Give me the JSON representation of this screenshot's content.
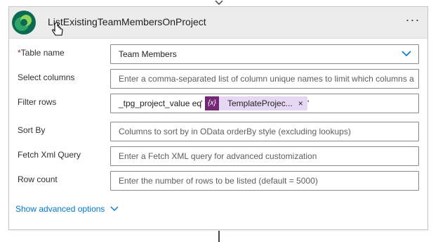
{
  "action": {
    "title": "ListExistingTeamMembersOnProject",
    "more_label": "···"
  },
  "fields": {
    "table_name": {
      "required_mark": "*",
      "label": "Table name",
      "value": "Team Members"
    },
    "select_columns": {
      "label": "Select columns",
      "placeholder": "Enter a comma-separated list of column unique names to limit which columns a"
    },
    "filter_rows": {
      "label": "Filter rows",
      "prefix": "_tpg_project_value eq",
      "open_quote": "'",
      "close_quote": "'",
      "token": {
        "icon_text": "{x}",
        "label": "TemplateProjec...",
        "close": "×"
      }
    },
    "sort_by": {
      "label": "Sort By",
      "placeholder": "Columns to sort by in OData orderBy style (excluding lookups)"
    },
    "fetch_xml": {
      "label": "Fetch Xml Query",
      "placeholder": "Enter a Fetch XML query for advanced customization"
    },
    "row_count": {
      "label": "Row count",
      "placeholder": "Enter the number of rows to be listed (default = 5000)"
    }
  },
  "advanced_options": {
    "label": "Show advanced options"
  },
  "colors": {
    "accent": "#0078d4",
    "token_bg": "#e6d8f4",
    "token_icon_bg": "#742774",
    "header_bg": "#ececec"
  },
  "icons": {
    "app": "dataverse-icon",
    "more": "more-options-icon",
    "dropdown": "chevron-down-icon",
    "expression": "expression-icon",
    "advanced": "chevron-down-icon"
  }
}
